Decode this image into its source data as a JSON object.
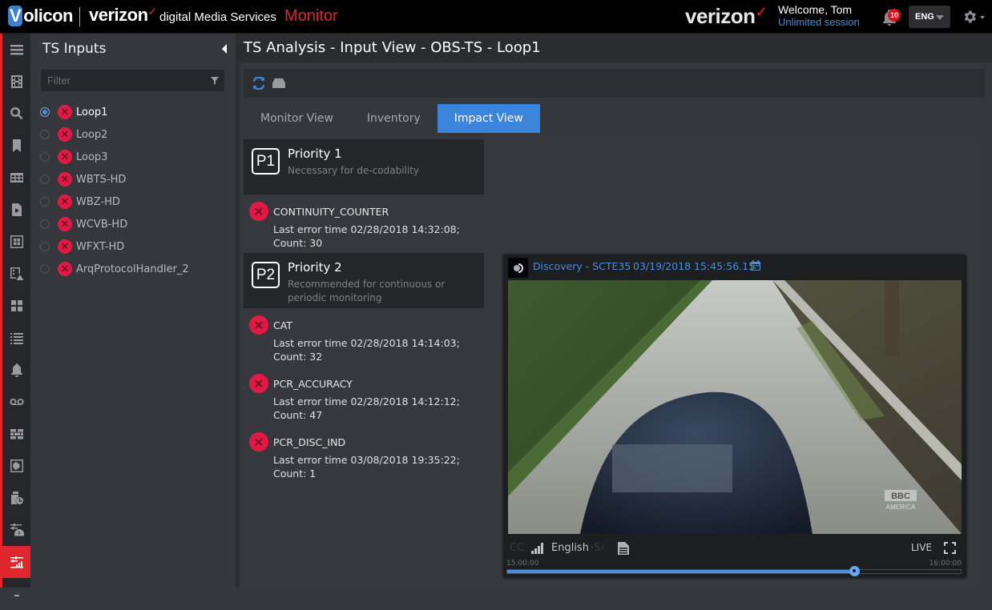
{
  "header": {
    "volicon_logo": "olicon",
    "volicon_logo_v": "V",
    "verizon_logo": "verizon",
    "product_line": "digital Media Services",
    "app_name": "Monitor",
    "brand_right": "verizon",
    "welcome": "Welcome, Tom",
    "session": "Unlimited session",
    "notifications_count": "10",
    "language": "ENG"
  },
  "leftnav": {
    "items": [
      "menu",
      "channels",
      "search",
      "bookmarks",
      "grid",
      "clip-player",
      "multiviewer",
      "alerts-channel",
      "dashboard",
      "list",
      "alarms",
      "recording",
      "walls",
      "contrast",
      "schedule",
      "settings-gauge",
      "ts-analysis"
    ],
    "active": "ts-analysis"
  },
  "inputs_panel": {
    "title": "TS Inputs",
    "filter_placeholder": "Filter",
    "items": [
      {
        "name": "Loop1",
        "selected": true,
        "status": "error"
      },
      {
        "name": "Loop2",
        "selected": false,
        "status": "error"
      },
      {
        "name": "Loop3",
        "selected": false,
        "status": "error"
      },
      {
        "name": "WBTS-HD",
        "selected": false,
        "status": "error"
      },
      {
        "name": "WBZ-HD",
        "selected": false,
        "status": "error"
      },
      {
        "name": "WCVB-HD",
        "selected": false,
        "status": "error"
      },
      {
        "name": "WFXT-HD",
        "selected": false,
        "status": "error"
      },
      {
        "name": "ArqProtocolHandler_2",
        "selected": false,
        "status": "error"
      }
    ]
  },
  "main": {
    "title": "TS Analysis - Input View - OBS-TS - Loop1",
    "tabs": [
      {
        "label": "Monitor View",
        "active": false
      },
      {
        "label": "Inventory",
        "active": false
      },
      {
        "label": "Impact View",
        "active": true
      }
    ],
    "priorities": [
      {
        "badge": "P1",
        "title": "Priority 1",
        "description": "Necessary for de-codability",
        "errors": [
          {
            "name": "CONTINUITY_COUNTER",
            "detail": "Last error time 02/28/2018 14:32:08; Count: 30"
          }
        ]
      },
      {
        "badge": "P2",
        "title": "Priority 2",
        "description": "Recommended for continuous or periodic monitoring",
        "errors": [
          {
            "name": "CAT",
            "detail": "Last error time 02/28/2018 14:14:03; Count: 32"
          },
          {
            "name": "PCR_ACCURACY",
            "detail": "Last error time 02/28/2018 14:12:12; Count: 47"
          },
          {
            "name": "PCR_DISC_IND",
            "detail": "Last error time 03/08/2018 19:35:22; Count: 1"
          }
        ]
      }
    ]
  },
  "player": {
    "channel": "Discovery - SCTE35",
    "timestamp": "03/19/2018 15:45:56.15",
    "watermark_top": "BBC",
    "watermark_bottom": "AMERICA",
    "cc_label": "CC",
    "audio_label": "English",
    "live_label": "LIVE",
    "timeline_start": "15:00:00",
    "timeline_end": "16:00:00",
    "timeline_progress_pct": 76.5,
    "accent_color": "#4a8ee0"
  }
}
